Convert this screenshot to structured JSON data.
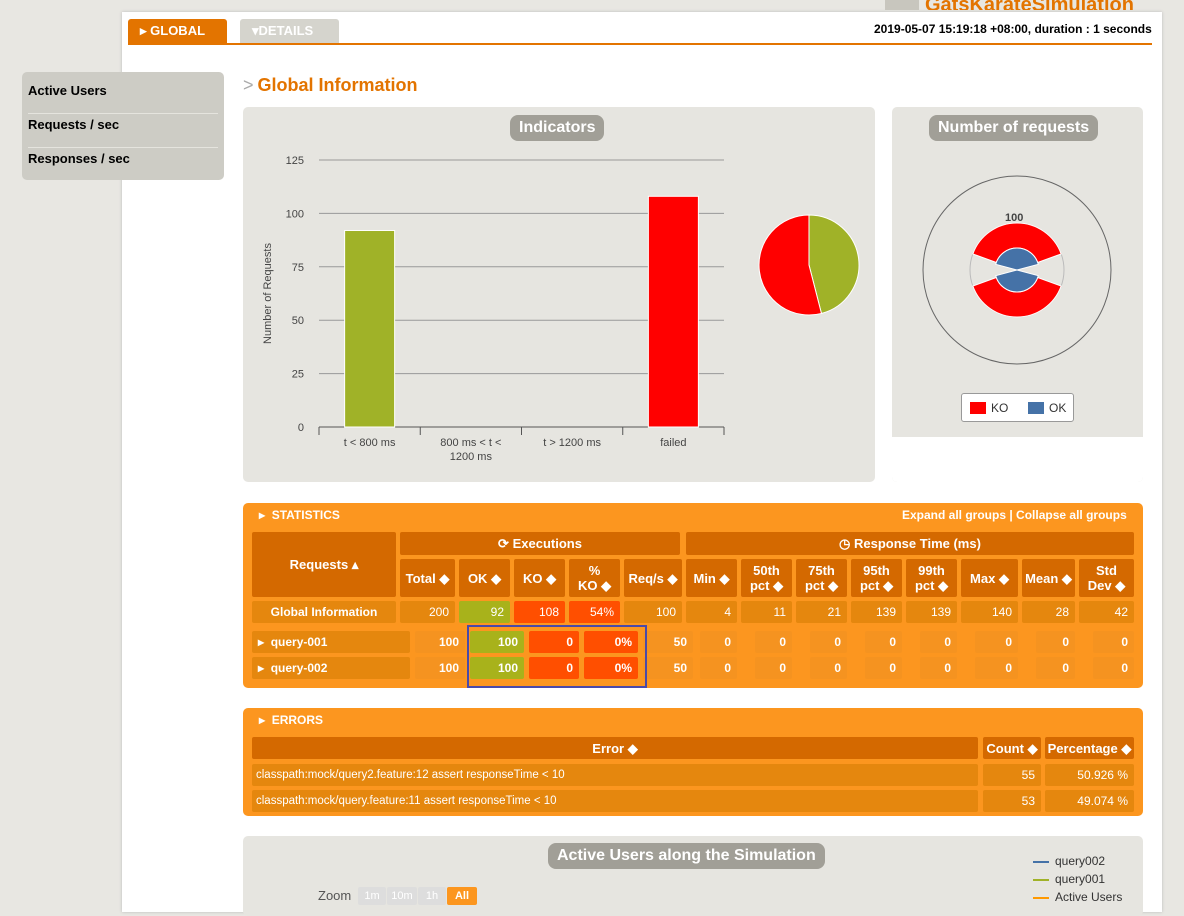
{
  "header": {
    "brand": "GatsKarateSimulation",
    "tab_global": "GLOBAL",
    "tab_details": "DETAILS",
    "run_info": "2019-05-07 15:19:18 +08:00, duration : 1 seconds"
  },
  "sidebar": {
    "items": [
      "Active Users",
      "Requests / sec",
      "Responses / sec"
    ]
  },
  "section_title": "Global Information",
  "indicators": {
    "title": "Indicators",
    "chart_data": {
      "type": "bar",
      "ylabel": "Number of Requests",
      "categories": [
        "t < 800 ms",
        "800 ms < t < 1200 ms",
        "t > 1200 ms",
        "failed"
      ],
      "category_lines": [
        [
          "t < 800 ms"
        ],
        [
          "800 ms < t <",
          "1200 ms"
        ],
        [
          "t > 1200 ms"
        ],
        [
          "failed"
        ]
      ],
      "values": [
        92,
        0,
        0,
        108
      ],
      "colors": [
        "#a0b228",
        "#ffdd00",
        "#ff9900",
        "#ff0000"
      ],
      "ylim": [
        0,
        125
      ],
      "yticks": [
        0,
        25,
        50,
        75,
        100,
        125
      ]
    },
    "pie": {
      "ok": 92,
      "ko": 108,
      "ok_color": "#a0b228",
      "ko_color": "#ff0000"
    }
  },
  "number_of_requests": {
    "title": "Number of requests",
    "label": "100",
    "legend": [
      "KO",
      "OK"
    ],
    "colors": {
      "ko": "#ff0000",
      "ok": "#4572a7"
    }
  },
  "statistics": {
    "title": "STATISTICS",
    "expand": "Expand all groups",
    "sep": " | ",
    "collapse": "Collapse all groups",
    "executions": "Executions",
    "response_time": "Response Time (ms)",
    "requests_header": "Requests",
    "cols": [
      "Total",
      "OK",
      "KO",
      "% KO",
      "Req/s",
      "Min",
      "50th pct",
      "75th pct",
      "95th pct",
      "99th pct",
      "Max",
      "Mean",
      "Std Dev"
    ],
    "col_lines": [
      [
        "Total"
      ],
      [
        "OK"
      ],
      [
        "KO"
      ],
      [
        "%",
        "KO"
      ],
      [
        "Req/s"
      ],
      [
        "Min"
      ],
      [
        "50th",
        "pct"
      ],
      [
        "75th",
        "pct"
      ],
      [
        "95th",
        "pct"
      ],
      [
        "99th",
        "pct"
      ],
      [
        "Max"
      ],
      [
        "Mean"
      ],
      [
        "Std",
        "Dev"
      ]
    ],
    "rows": [
      {
        "name": "Global Information",
        "values": [
          "200",
          "92",
          "108",
          "54%",
          "100",
          "4",
          "11",
          "21",
          "139",
          "139",
          "140",
          "28",
          "42"
        ]
      },
      {
        "name": "query-001",
        "values": [
          "100",
          "100",
          "0",
          "0%",
          "50",
          "0",
          "0",
          "0",
          "0",
          "0",
          "0",
          "0",
          "0"
        ]
      },
      {
        "name": "query-002",
        "values": [
          "100",
          "100",
          "0",
          "0%",
          "50",
          "0",
          "0",
          "0",
          "0",
          "0",
          "0",
          "0",
          "0"
        ]
      }
    ]
  },
  "errors": {
    "title": "ERRORS",
    "cols": [
      "Error",
      "Count",
      "Percentage"
    ],
    "rows": [
      {
        "error": "classpath:mock/query2.feature:12 assert responseTime < 10",
        "count": "55",
        "pct": "50.926 %"
      },
      {
        "error": "classpath:mock/query.feature:11 assert responseTime < 10",
        "count": "53",
        "pct": "49.074 %"
      }
    ]
  },
  "active_users": {
    "title": "Active Users along the Simulation",
    "zoom_label": "Zoom",
    "zoom_buttons": [
      "1m",
      "10m",
      "1h",
      "All"
    ],
    "legend": [
      "query002",
      "query001",
      "Active Users"
    ],
    "legend_colors": [
      "#4572a7",
      "#a0b228",
      "#ff9900"
    ]
  }
}
